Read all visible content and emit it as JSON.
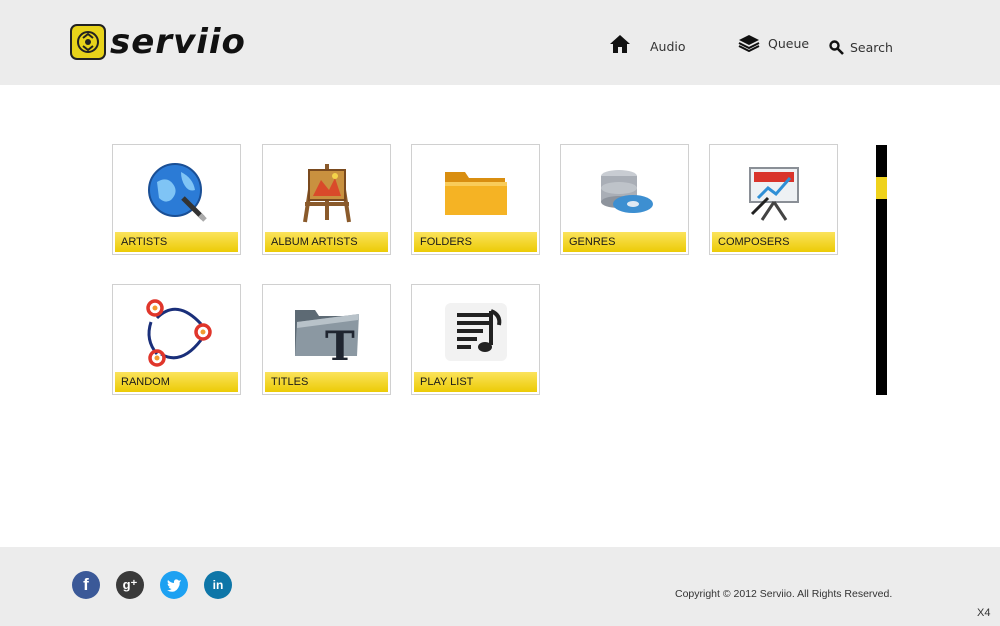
{
  "brand": {
    "name": "serviio",
    "accent": "#eccb06"
  },
  "nav": {
    "home_icon": "house-icon",
    "audio_label": "Audio",
    "queue_label": "Queue",
    "queue_icon": "stack-layers-icon",
    "search_label": "Search",
    "search_icon": "magnifier-icon"
  },
  "tiles": [
    {
      "label": "ARTISTS",
      "icon": "globe-with-pen-icon"
    },
    {
      "label": "ALBUM ARTISTS",
      "icon": "easel-painting-icon"
    },
    {
      "label": "FOLDERS",
      "icon": "folder-icon"
    },
    {
      "label": "GENRES",
      "icon": "database-disc-icon"
    },
    {
      "label": "COMPOSERS",
      "icon": "presentation-board-icon"
    },
    {
      "label": "RANDOM",
      "icon": "random-cycle-icon"
    },
    {
      "label": "TITLES",
      "icon": "folder-text-icon"
    },
    {
      "label": "PLAY LIST",
      "icon": "playlist-note-icon"
    }
  ],
  "footer": {
    "social": [
      {
        "name": "facebook",
        "glyph": "f",
        "color": "#3b5998"
      },
      {
        "name": "google-plus",
        "glyph": "g⁺",
        "color": "#3a3a3a"
      },
      {
        "name": "twitter",
        "glyph": "t",
        "color": "#1da1f2"
      },
      {
        "name": "linkedin",
        "glyph": "in",
        "color": "#0e76a8"
      }
    ],
    "copyright": "Copyright © 2012 Serviio. All Rights Reserved."
  },
  "corner_label": "X4"
}
